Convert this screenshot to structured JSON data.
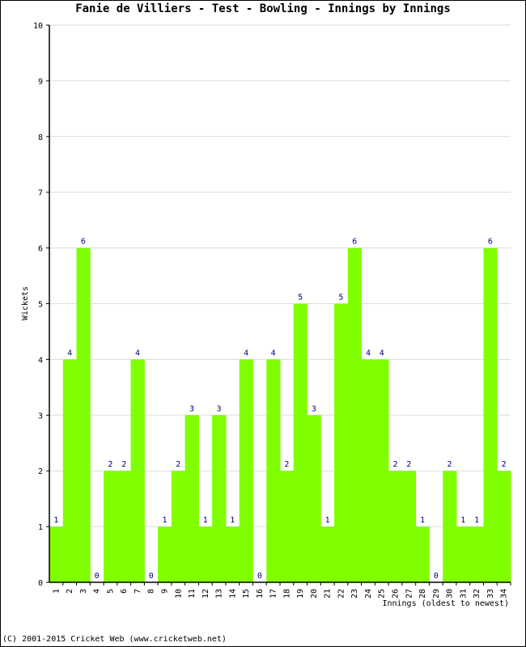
{
  "chart_data": {
    "type": "bar",
    "title": "Fanie de Villiers - Test - Bowling - Innings by Innings",
    "xlabel": "Innings (oldest to newest)",
    "ylabel": "Wickets",
    "ylim": [
      0,
      10
    ],
    "yticks": [
      0,
      1,
      2,
      3,
      4,
      5,
      6,
      7,
      8,
      9,
      10
    ],
    "grid": true,
    "bar_color": "#80ff00",
    "label_color": "#000080",
    "categories": [
      "1",
      "2",
      "3",
      "4",
      "5",
      "6",
      "7",
      "8",
      "9",
      "10",
      "11",
      "12",
      "13",
      "14",
      "15",
      "16",
      "17",
      "18",
      "19",
      "20",
      "21",
      "22",
      "23",
      "24",
      "25",
      "26",
      "27",
      "28",
      "29",
      "30",
      "31",
      "32",
      "33",
      "34"
    ],
    "values": [
      1,
      4,
      6,
      0,
      2,
      2,
      4,
      0,
      1,
      2,
      3,
      1,
      3,
      1,
      4,
      0,
      4,
      2,
      5,
      3,
      1,
      5,
      6,
      4,
      4,
      2,
      2,
      1,
      0,
      2,
      1,
      1,
      6,
      2
    ]
  },
  "footer": "(C) 2001-2015 Cricket Web (www.cricketweb.net)"
}
